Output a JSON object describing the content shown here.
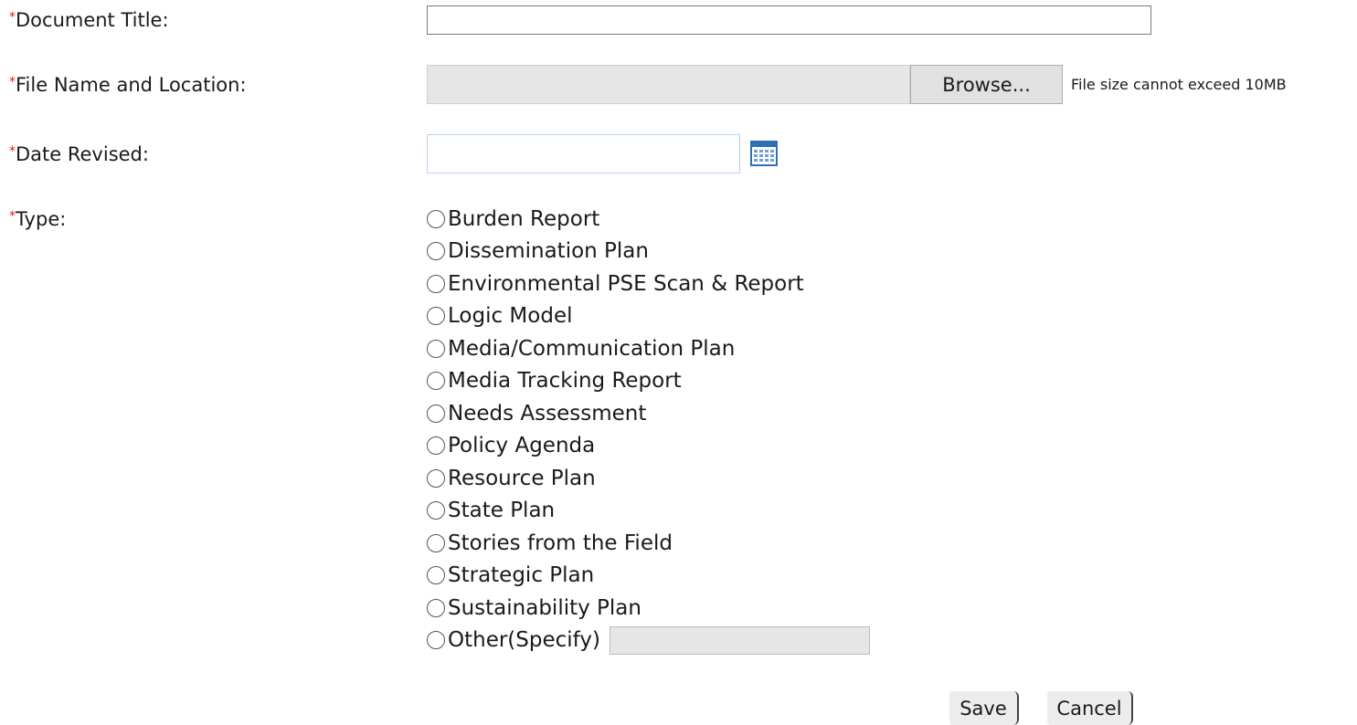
{
  "form": {
    "required_marker": "*",
    "document_title": {
      "label": "Document Title:",
      "value": ""
    },
    "file": {
      "label": "File Name and Location:",
      "browse_label": "Browse...",
      "size_note": "File size cannot exceed 10MB"
    },
    "date_revised": {
      "label": "Date Revised:",
      "value": "",
      "icon": "calendar-icon"
    },
    "type": {
      "label": "Type:",
      "options": [
        "Burden Report",
        "Dissemination Plan",
        "Environmental PSE Scan & Report",
        "Logic Model",
        "Media/Communication Plan",
        "Media Tracking Report",
        "Needs Assessment",
        "Policy Agenda",
        "Resource Plan",
        "State Plan",
        "Stories from the Field",
        "Strategic Plan",
        "Sustainability Plan",
        "Other(Specify)"
      ],
      "selected": null,
      "other_value": ""
    }
  },
  "actions": {
    "save_label": "Save",
    "cancel_label": "Cancel"
  },
  "colors": {
    "required": "#e0201b",
    "calendar_icon": "#2f6fb8",
    "disabled_field": "#e6e6e6"
  }
}
